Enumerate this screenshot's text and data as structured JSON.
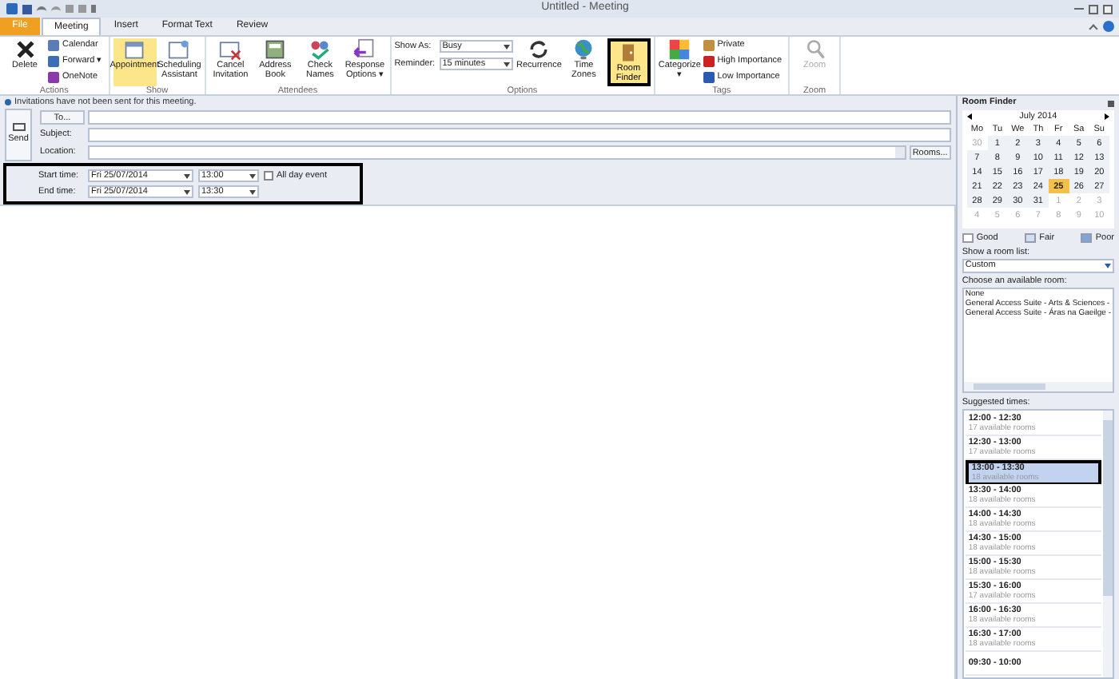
{
  "window": {
    "title": "Untitled - Meeting"
  },
  "tabs": [
    {
      "label": "File",
      "kind": "file",
      "selected": false
    },
    {
      "label": "Meeting",
      "kind": "tab",
      "selected": true
    },
    {
      "label": "Insert",
      "kind": "tab",
      "selected": false
    },
    {
      "label": "Format Text",
      "kind": "tab",
      "selected": false
    },
    {
      "label": "Review",
      "kind": "tab",
      "selected": false
    }
  ],
  "ribbon": [
    {
      "label": "Actions",
      "items": [
        {
          "kind": "large",
          "label": "Delete",
          "selected": false,
          "outlined": false,
          "disabled": false
        },
        {
          "kind": "stack",
          "entries": [
            "Calendar",
            "Forward ▾",
            "OneNote"
          ]
        }
      ]
    },
    {
      "label": "Show",
      "items": [
        {
          "kind": "large",
          "label": "Appointment",
          "selected": true,
          "outlined": false,
          "disabled": false
        },
        {
          "kind": "large",
          "label": "Scheduling Assistant",
          "selected": false,
          "outlined": false,
          "disabled": false
        }
      ]
    },
    {
      "label": "Attendees",
      "items": [
        {
          "kind": "large",
          "label": "Cancel Invitation",
          "selected": false,
          "outlined": false,
          "disabled": false
        },
        {
          "kind": "large",
          "label": "Address Book",
          "selected": false,
          "outlined": false,
          "disabled": false
        },
        {
          "kind": "large",
          "label": "Check Names",
          "selected": false,
          "outlined": false,
          "disabled": false
        },
        {
          "kind": "large",
          "label": "Response Options ▾",
          "selected": false,
          "outlined": false,
          "disabled": false
        }
      ]
    },
    {
      "label": "Options",
      "items": [
        {
          "kind": "fields",
          "entries": [
            {
              "label": "Show As:",
              "value": "Busy"
            },
            {
              "label": "Reminder:",
              "value": "15 minutes"
            }
          ]
        },
        {
          "kind": "large",
          "label": "Recurrence",
          "selected": false,
          "outlined": false,
          "disabled": false
        },
        {
          "kind": "large",
          "label": "Time Zones",
          "selected": false,
          "outlined": false,
          "disabled": false
        },
        {
          "kind": "large",
          "label": "Room Finder",
          "selected": true,
          "outlined": true,
          "disabled": false
        }
      ]
    },
    {
      "label": "Tags",
      "items": [
        {
          "kind": "large",
          "label": "Categorize ▾",
          "selected": false,
          "outlined": false,
          "disabled": false
        },
        {
          "kind": "stack",
          "entries": [
            "Private",
            "High Importance",
            "Low Importance"
          ]
        }
      ]
    },
    {
      "label": "Zoom",
      "items": [
        {
          "kind": "large",
          "label": "Zoom",
          "selected": false,
          "outlined": false,
          "disabled": true
        }
      ]
    }
  ],
  "info_bar": "Invitations have not been sent for this meeting.",
  "form": {
    "send": "Send",
    "to": "To...",
    "subject": "Subject:",
    "location": "Location:",
    "rooms": "Rooms..."
  },
  "times": {
    "outlined": true,
    "all_day": {
      "label": "All day event",
      "checked": false
    },
    "rows": [
      {
        "label": "Start time:",
        "date": "Fri 25/07/2014",
        "time": "13:00"
      },
      {
        "label": "End time:",
        "date": "Fri 25/07/2014",
        "time": "13:30"
      }
    ]
  },
  "room_finder": {
    "title": "Room Finder",
    "month": "July 2014",
    "weekdays": [
      "Mo",
      "Tu",
      "We",
      "Th",
      "Fr",
      "Sa",
      "Su"
    ],
    "weeks": [
      [
        {
          "label": "30",
          "muted": true,
          "selected": false
        },
        {
          "label": "1",
          "muted": false,
          "selected": false
        },
        {
          "label": "2",
          "muted": false,
          "selected": false
        },
        {
          "label": "3",
          "muted": false,
          "selected": false
        },
        {
          "label": "4",
          "muted": false,
          "selected": false
        },
        {
          "label": "5",
          "muted": false,
          "selected": false
        },
        {
          "label": "6",
          "muted": false,
          "selected": false
        }
      ],
      [
        {
          "label": "7",
          "muted": false,
          "selected": false
        },
        {
          "label": "8",
          "muted": false,
          "selected": false
        },
        {
          "label": "9",
          "muted": false,
          "selected": false
        },
        {
          "label": "10",
          "muted": false,
          "selected": false
        },
        {
          "label": "11",
          "muted": false,
          "selected": false
        },
        {
          "label": "12",
          "muted": false,
          "selected": false
        },
        {
          "label": "13",
          "muted": false,
          "selected": false
        }
      ],
      [
        {
          "label": "14",
          "muted": false,
          "selected": false
        },
        {
          "label": "15",
          "muted": false,
          "selected": false
        },
        {
          "label": "16",
          "muted": false,
          "selected": false
        },
        {
          "label": "17",
          "muted": false,
          "selected": false
        },
        {
          "label": "18",
          "muted": false,
          "selected": false
        },
        {
          "label": "19",
          "muted": false,
          "selected": false
        },
        {
          "label": "20",
          "muted": false,
          "selected": false
        }
      ],
      [
        {
          "label": "21",
          "muted": false,
          "selected": false
        },
        {
          "label": "22",
          "muted": false,
          "selected": false
        },
        {
          "label": "23",
          "muted": false,
          "selected": false
        },
        {
          "label": "24",
          "muted": false,
          "selected": false
        },
        {
          "label": "25",
          "muted": false,
          "selected": true
        },
        {
          "label": "26",
          "muted": false,
          "selected": false
        },
        {
          "label": "27",
          "muted": false,
          "selected": false
        }
      ],
      [
        {
          "label": "28",
          "muted": false,
          "selected": false
        },
        {
          "label": "29",
          "muted": false,
          "selected": false
        },
        {
          "label": "30",
          "muted": false,
          "selected": false
        },
        {
          "label": "31",
          "muted": false,
          "selected": false
        },
        {
          "label": "1",
          "muted": true,
          "selected": false
        },
        {
          "label": "2",
          "muted": true,
          "selected": false
        },
        {
          "label": "3",
          "muted": true,
          "selected": false
        }
      ],
      [
        {
          "label": "4",
          "muted": true,
          "selected": false
        },
        {
          "label": "5",
          "muted": true,
          "selected": false
        },
        {
          "label": "6",
          "muted": true,
          "selected": false
        },
        {
          "label": "7",
          "muted": true,
          "selected": false
        },
        {
          "label": "8",
          "muted": true,
          "selected": false
        },
        {
          "label": "9",
          "muted": true,
          "selected": false
        },
        {
          "label": "10",
          "muted": true,
          "selected": false
        }
      ]
    ],
    "legend": [
      {
        "label": "Good",
        "color": "#ffffff"
      },
      {
        "label": "Fair",
        "color": "#cfe0f5"
      },
      {
        "label": "Poor",
        "color": "#7fa6db"
      }
    ],
    "room_list_label": "Show a room list:",
    "room_list_value": "Custom",
    "rooms_label": "Choose an available room:",
    "rooms": [
      "None",
      "General Access Suite - Arts & Sciences -",
      "General Access Suite - Áras na Gaeilge -"
    ],
    "suggested_label": "Suggested times:",
    "suggested": [
      {
        "time": "12:00 - 12:30",
        "rooms": "17 available rooms",
        "selected": false
      },
      {
        "time": "12:30 - 13:00",
        "rooms": "17 available rooms",
        "selected": false
      },
      {
        "time": "13:00 - 13:30",
        "rooms": "18 available rooms",
        "selected": true
      },
      {
        "time": "13:30 - 14:00",
        "rooms": "18 available rooms",
        "selected": false
      },
      {
        "time": "14:00 - 14:30",
        "rooms": "18 available rooms",
        "selected": false
      },
      {
        "time": "14:30 - 15:00",
        "rooms": "18 available rooms",
        "selected": false
      },
      {
        "time": "15:00 - 15:30",
        "rooms": "18 available rooms",
        "selected": false
      },
      {
        "time": "15:30 - 16:00",
        "rooms": "17 available rooms",
        "selected": false
      },
      {
        "time": "16:00 - 16:30",
        "rooms": "18 available rooms",
        "selected": false
      },
      {
        "time": "16:30 - 17:00",
        "rooms": "18 available rooms",
        "selected": false
      },
      {
        "time": "09:30 - 10:00",
        "selected": false
      }
    ]
  }
}
